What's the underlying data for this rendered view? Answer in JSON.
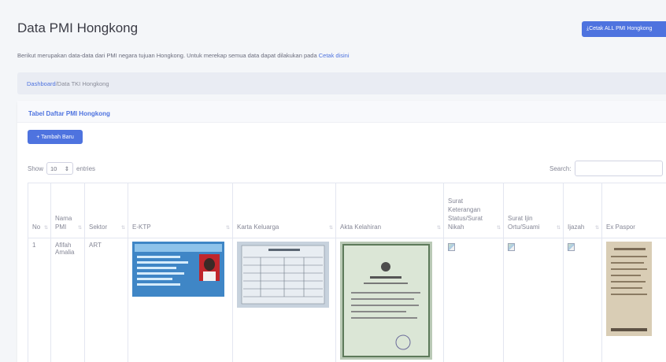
{
  "page": {
    "title": "Data PMI Hongkong",
    "cetak_button": "⤓Cetak ALL PMI Hongkong",
    "description_prefix": "Berikut merupakan data-data dari PMI negara tujuan Hongkong. Untuk merekap semua data dapat dilakukan pada ",
    "description_link": "Cetak disini"
  },
  "breadcrumb": {
    "link": "Dashboard",
    "current": "/Data TKI Hongkong"
  },
  "card": {
    "title": "Tabel Daftar PMI Hongkong",
    "add_button": "+ Tambah Baru"
  },
  "datatable": {
    "show_label": "Show",
    "entries_value": "10",
    "entries_label": "entries",
    "search_label": "Search:",
    "search_value": "",
    "columns": [
      "No",
      "Nama PMI",
      "Sektor",
      "E-KTP",
      "Karta Keluarga",
      "Akta Kelahiran",
      "Surat Keterangan Status/Surat Nikah",
      "Surat Ijin Ortu/Suami",
      "Ijazah",
      "Ex Paspor"
    ],
    "rows": [
      {
        "no": "1",
        "nama": "Afifah Amalia",
        "sektor": "ART"
      }
    ]
  },
  "colors": {
    "primary": "#4e73df",
    "background": "#f4f6f9",
    "text": "#858796"
  }
}
